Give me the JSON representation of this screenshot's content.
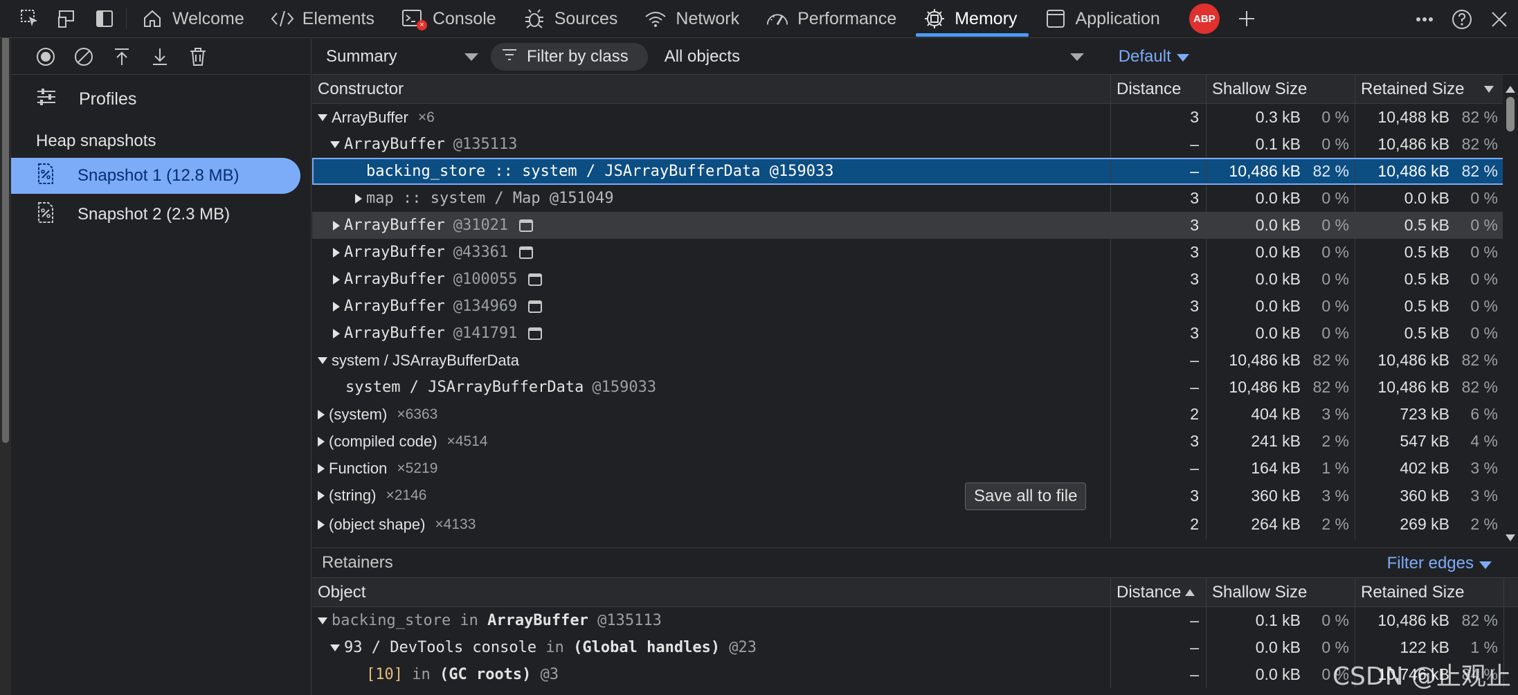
{
  "tabs": [
    {
      "label": "Welcome",
      "icon": "home-icon"
    },
    {
      "label": "Elements",
      "icon": "code-icon"
    },
    {
      "label": "Console",
      "icon": "console-icon"
    },
    {
      "label": "Sources",
      "icon": "bug-icon"
    },
    {
      "label": "Network",
      "icon": "wifi-icon"
    },
    {
      "label": "Performance",
      "icon": "gauge-icon"
    },
    {
      "label": "Memory",
      "icon": "chip-icon",
      "active": true
    },
    {
      "label": "Application",
      "icon": "app-icon"
    }
  ],
  "abp_label": "ABP",
  "sidebar": {
    "profiles_label": "Profiles",
    "heap_title": "Heap snapshots",
    "snapshots": [
      {
        "label": "Snapshot 1 (12.8 MB)",
        "selected": true
      },
      {
        "label": "Snapshot 2 (2.3 MB)",
        "selected": false
      }
    ]
  },
  "toolbar": {
    "view": "Summary",
    "filter_placeholder": "Filter by class",
    "objects": "All objects",
    "default_label": "Default"
  },
  "main_table": {
    "headers": {
      "name": "Constructor",
      "distance": "Distance",
      "shallow": "Shallow Size",
      "retained": "Retained Size"
    },
    "rows": [
      {
        "name": "ArrayBuffer",
        "count": "×6",
        "distance": "3",
        "shallow": "0.3 kB",
        "shallow_pct": "0 %",
        "retained": "10,488 kB",
        "retained_pct": "82 %"
      },
      {
        "name": "ArrayBuffer",
        "id": "@135113",
        "distance": "–",
        "shallow": "0.1 kB",
        "shallow_pct": "0 %",
        "retained": "10,486 kB",
        "retained_pct": "82 %"
      },
      {
        "name": "backing_store :: system / JSArrayBufferData @159033",
        "distance": "–",
        "shallow": "10,486 kB",
        "shallow_pct": "82 %",
        "retained": "10,486 kB",
        "retained_pct": "82 %"
      },
      {
        "name": "map :: system / Map @151049",
        "distance": "3",
        "shallow": "0.0 kB",
        "shallow_pct": "0 %",
        "retained": "0.0 kB",
        "retained_pct": "0 %"
      },
      {
        "name": "ArrayBuffer",
        "id": "@31021",
        "distance": "3",
        "shallow": "0.0 kB",
        "shallow_pct": "0 %",
        "retained": "0.5 kB",
        "retained_pct": "0 %"
      },
      {
        "name": "ArrayBuffer",
        "id": "@43361",
        "distance": "3",
        "shallow": "0.0 kB",
        "shallow_pct": "0 %",
        "retained": "0.5 kB",
        "retained_pct": "0 %"
      },
      {
        "name": "ArrayBuffer",
        "id": "@100055",
        "distance": "3",
        "shallow": "0.0 kB",
        "shallow_pct": "0 %",
        "retained": "0.5 kB",
        "retained_pct": "0 %"
      },
      {
        "name": "ArrayBuffer",
        "id": "@134969",
        "distance": "3",
        "shallow": "0.0 kB",
        "shallow_pct": "0 %",
        "retained": "0.5 kB",
        "retained_pct": "0 %"
      },
      {
        "name": "ArrayBuffer",
        "id": "@141791",
        "distance": "3",
        "shallow": "0.0 kB",
        "shallow_pct": "0 %",
        "retained": "0.5 kB",
        "retained_pct": "0 %"
      },
      {
        "name": "system / JSArrayBufferData",
        "distance": "–",
        "shallow": "10,486 kB",
        "shallow_pct": "82 %",
        "retained": "10,486 kB",
        "retained_pct": "82 %"
      },
      {
        "name": "system / JSArrayBufferData",
        "id": "@159033",
        "distance": "–",
        "shallow": "10,486 kB",
        "shallow_pct": "82 %",
        "retained": "10,486 kB",
        "retained_pct": "82 %"
      },
      {
        "name": "(system)",
        "count": "×6363",
        "distance": "2",
        "shallow": "404 kB",
        "shallow_pct": "3 %",
        "retained": "723 kB",
        "retained_pct": "6 %"
      },
      {
        "name": "(compiled code)",
        "count": "×4514",
        "distance": "3",
        "shallow": "241 kB",
        "shallow_pct": "2 %",
        "retained": "547 kB",
        "retained_pct": "4 %"
      },
      {
        "name": "Function",
        "count": "×5219",
        "distance": "–",
        "shallow": "164 kB",
        "shallow_pct": "1 %",
        "retained": "402 kB",
        "retained_pct": "3 %"
      },
      {
        "name": "(string)",
        "count": "×2146",
        "distance": "3",
        "shallow": "360 kB",
        "shallow_pct": "3 %",
        "retained": "360 kB",
        "retained_pct": "3 %"
      },
      {
        "name": "(object shape)",
        "count": "×4133",
        "distance": "2",
        "shallow": "264 kB",
        "shallow_pct": "2 %",
        "retained": "269 kB",
        "retained_pct": "2 %"
      }
    ]
  },
  "save_button": "Save all to file",
  "retainers": {
    "title": "Retainers",
    "filter_edges": "Filter edges",
    "headers": {
      "name": "Object",
      "distance": "Distance",
      "shallow": "Shallow Size",
      "retained": "Retained Size"
    },
    "rows": [
      {
        "name_a": "backing_store",
        "name_b": " in ",
        "name_c": "ArrayBuffer",
        "name_d": " @135113",
        "distance": "–",
        "shallow": "0.1 kB",
        "shallow_pct": "0 %",
        "retained": "10,486 kB",
        "retained_pct": "82 %"
      },
      {
        "name_a": "93 / DevTools console",
        "name_b": " in ",
        "name_c": "(Global handles)",
        "name_d": " @23",
        "distance": "–",
        "shallow": "0.0 kB",
        "shallow_pct": "0 %",
        "retained": "122 kB",
        "retained_pct": "1 %"
      },
      {
        "name_a": "[10]",
        "name_b": " in ",
        "name_c": "(GC roots)",
        "name_d": " @3",
        "distance": "–",
        "shallow": "0.0 kB",
        "shallow_pct": "0 %",
        "retained": "10,746 kB",
        "retained_pct": "84 %"
      }
    ]
  },
  "watermark": "CSDN @止观止"
}
